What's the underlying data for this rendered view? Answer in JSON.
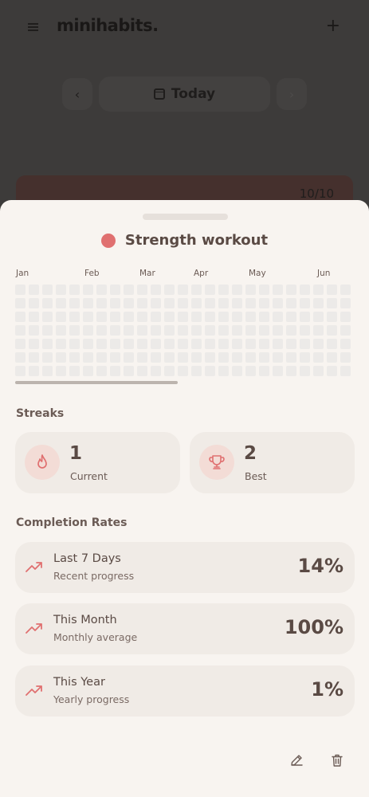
{
  "app": {
    "brand": "minihabits.",
    "menu_icon": "menu-icon",
    "add_icon": "plus-icon",
    "date_label": "Today",
    "prev_icon": "chevron-left-icon",
    "next_icon": "chevron-right-icon",
    "bg_card_count": "10/10"
  },
  "habit": {
    "name": "Strength workout",
    "color": "#e07070"
  },
  "heatmap": {
    "months": [
      "Jan",
      "Feb",
      "Mar",
      "Apr",
      "May",
      "Jun"
    ],
    "rows": 7,
    "columns": 25,
    "empty_color": "#eceae8"
  },
  "streaks": {
    "label": "Streaks",
    "current": {
      "value": "1",
      "label": "Current",
      "icon": "flame-icon"
    },
    "best": {
      "value": "2",
      "label": "Best",
      "icon": "trophy-icon"
    }
  },
  "completion": {
    "label": "Completion Rates",
    "rates": [
      {
        "title": "Last 7 Days",
        "subtitle": "Recent progress",
        "value": "14%",
        "icon": "trending-up-icon"
      },
      {
        "title": "This Month",
        "subtitle": "Monthly average",
        "value": "100%",
        "icon": "trending-up-icon"
      },
      {
        "title": "This Year",
        "subtitle": "Yearly progress",
        "value": "1%",
        "icon": "trending-up-icon"
      }
    ]
  },
  "actions": {
    "edit_icon": "pencil-icon",
    "delete_icon": "trash-icon"
  },
  "colors": {
    "accent": "#e07070",
    "sheet_bg": "#f8f4f0",
    "card_bg": "#f0ebe6",
    "text": "#5a4a44"
  }
}
